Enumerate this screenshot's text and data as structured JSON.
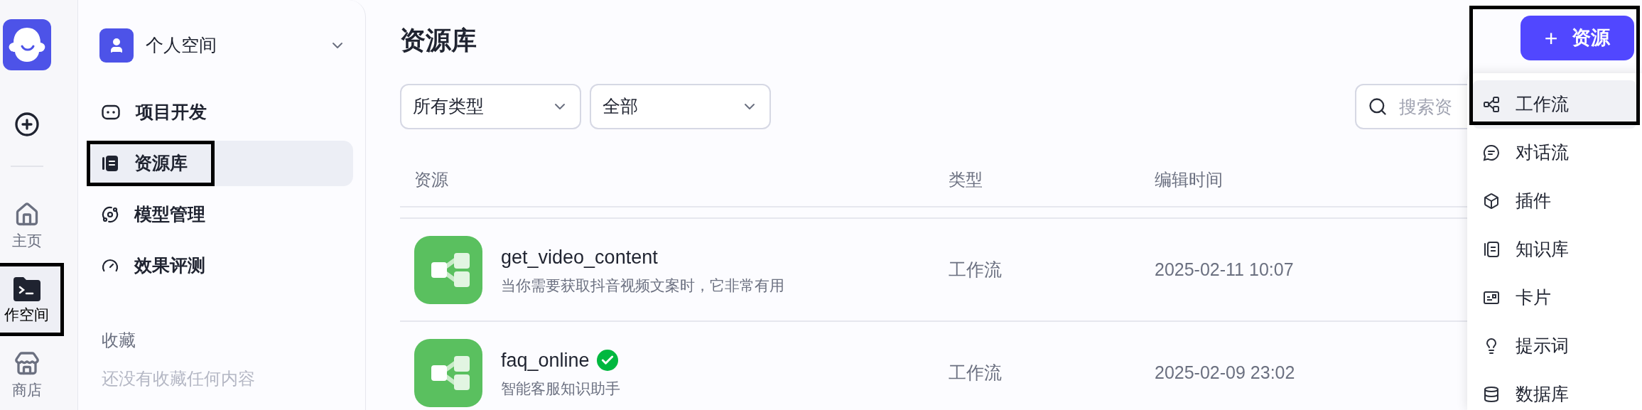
{
  "rail": {
    "items": [
      {
        "kind": "home",
        "label": "主页",
        "selected": false,
        "outlined": false
      },
      {
        "kind": "workspace",
        "label": "作空间",
        "selected": true,
        "outlined": true
      },
      {
        "kind": "store",
        "label": "商店",
        "selected": false,
        "outlined": false
      }
    ]
  },
  "sidebar": {
    "space": "个人空间",
    "items": [
      {
        "kind": "project",
        "label": "项目开发",
        "selected": false,
        "outlined": false
      },
      {
        "kind": "library",
        "label": "资源库",
        "selected": true,
        "outlined": true
      },
      {
        "kind": "model",
        "label": "模型管理",
        "selected": false,
        "outlined": false
      },
      {
        "kind": "eval",
        "label": "效果评测",
        "selected": false,
        "outlined": false
      }
    ],
    "favorites": {
      "title": "收藏",
      "empty": "还没有收藏任何内容"
    }
  },
  "main": {
    "title": "资源库",
    "filters": [
      {
        "value": "所有类型"
      },
      {
        "value": "全部"
      }
    ],
    "search": {
      "placeholder": "搜索资"
    },
    "table": {
      "columns": [
        "资源",
        "类型",
        "编辑时间"
      ],
      "rows": [
        {
          "name": "get_video_content",
          "verified": false,
          "description": "当你需要获取抖音视频文案时，它非常有用",
          "type": "工作流",
          "edited": "2025-02-11 10:07"
        },
        {
          "name": "faq_online",
          "verified": true,
          "description": "智能客服知识助手",
          "type": "工作流",
          "edited": "2025-02-09 23:02"
        }
      ]
    }
  },
  "new_menu": {
    "button": {
      "icon": "+",
      "label": "资源"
    },
    "outlined": true,
    "items": [
      {
        "kind": "workflow",
        "label": "工作流",
        "selected": true
      },
      {
        "kind": "chatflow",
        "label": "对话流",
        "selected": false
      },
      {
        "kind": "plugin",
        "label": "插件",
        "selected": false
      },
      {
        "kind": "knowledge",
        "label": "知识库",
        "selected": false
      },
      {
        "kind": "card",
        "label": "卡片",
        "selected": false
      },
      {
        "kind": "prompt",
        "label": "提示词",
        "selected": false
      },
      {
        "kind": "database",
        "label": "数据库",
        "selected": false
      }
    ]
  }
}
